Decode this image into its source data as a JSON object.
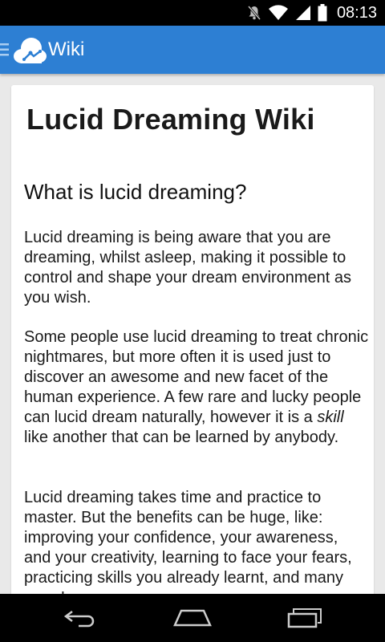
{
  "status_bar": {
    "time": "08:13",
    "icons": [
      "mute-icon",
      "wifi-icon",
      "signal-icon",
      "battery-icon"
    ]
  },
  "action_bar": {
    "title": "Wiki",
    "color": "#2d7fd3",
    "logo_icon": "cloud-logo-icon"
  },
  "article": {
    "title": "Lucid Dreaming Wiki",
    "heading": "What is lucid dreaming?",
    "p1": "Lucid dreaming is being aware that you are dreaming, whilst asleep, making it possible to control and shape your dream environment as you wish.",
    "p2_before": "Some people use lucid dreaming to treat chronic nightmares, but more often it is used just to discover an awesome and new facet of the human experience. A few rare and lucky people can lucid dream naturally, however it is a ",
    "p2_emphasis": "skill",
    "p2_after": " like another that can be learned by anybody.",
    "p3": "Lucid dreaming takes time and practice to master. But the benefits can be huge, like: improving your confidence, your awareness, and your creativity, learning to face your fears, practicing skills you already learnt, and many more!"
  },
  "nav_bar": {
    "buttons": [
      "back-icon",
      "home-icon",
      "recents-icon"
    ]
  }
}
